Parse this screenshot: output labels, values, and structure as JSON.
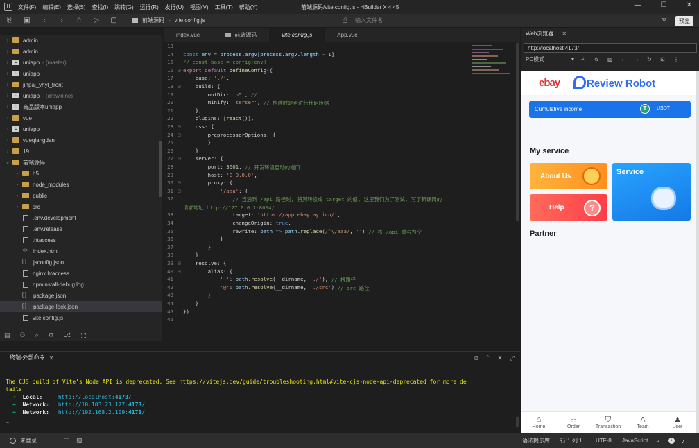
{
  "window": {
    "title": "前端源码/vite.config.js - HBuilder X 4.45",
    "menu": [
      "文件(F)",
      "编辑(E)",
      "选择(S)",
      "查找(I)",
      "跳转(G)",
      "运行(R)",
      "发行(U)",
      "视图(V)",
      "工具(T)",
      "帮助(Y)"
    ]
  },
  "toolbar": {
    "breadcrumb": [
      "前端源码",
      "vite.config.js"
    ],
    "search_placeholder": "输入文件名",
    "preview_label": "预览"
  },
  "sidebar": {
    "items": [
      {
        "label": "admin",
        "suffix": "",
        "level": 0,
        "icon": "folder",
        "arrow": "›"
      },
      {
        "label": "admin",
        "suffix": "",
        "level": 0,
        "icon": "folder",
        "arrow": "›"
      },
      {
        "label": "uniapp",
        "suffix": "- (master)",
        "level": 0,
        "icon": "u",
        "arrow": "›"
      },
      {
        "label": "uniapp",
        "suffix": "",
        "level": 0,
        "icon": "u",
        "arrow": "›"
      },
      {
        "label": "jinpai_yhyl_front",
        "suffix": "",
        "level": 0,
        "icon": "folder",
        "arrow": "›"
      },
      {
        "label": "uniapp",
        "suffix": "- (drawkline)",
        "level": 0,
        "icon": "u",
        "arrow": "›"
      },
      {
        "label": "商品版本uniapp",
        "suffix": "",
        "level": 0,
        "icon": "u",
        "arrow": "›"
      },
      {
        "label": "vue",
        "suffix": "",
        "level": 0,
        "icon": "folder",
        "arrow": "›"
      },
      {
        "label": "uniapp",
        "suffix": "",
        "level": 0,
        "icon": "u",
        "arrow": "›"
      },
      {
        "label": "vueqiangdan",
        "suffix": "",
        "level": 0,
        "icon": "folder",
        "arrow": "›"
      },
      {
        "label": "19",
        "suffix": "",
        "level": 0,
        "icon": "folder",
        "arrow": "›"
      },
      {
        "label": "前端源码",
        "suffix": "",
        "level": 0,
        "icon": "folder",
        "arrow": "⌄"
      },
      {
        "label": "h5",
        "suffix": "",
        "level": 1,
        "icon": "folder",
        "arrow": "›"
      },
      {
        "label": "node_modules",
        "suffix": "",
        "level": 1,
        "icon": "folder",
        "arrow": "›"
      },
      {
        "label": "public",
        "suffix": "",
        "level": 1,
        "icon": "folder",
        "arrow": "›"
      },
      {
        "label": "src",
        "suffix": "",
        "level": 1,
        "icon": "folder",
        "arrow": "›"
      },
      {
        "label": ".env.development",
        "suffix": "",
        "level": 1,
        "icon": "file",
        "arrow": ""
      },
      {
        "label": ".env.release",
        "suffix": "",
        "level": 1,
        "icon": "file",
        "arrow": ""
      },
      {
        "label": ".htaccess",
        "suffix": "",
        "level": 1,
        "icon": "file",
        "arrow": ""
      },
      {
        "label": "index.html",
        "suffix": "",
        "level": 1,
        "icon": "html",
        "arrow": ""
      },
      {
        "label": "jsconfig.json",
        "suffix": "",
        "level": 1,
        "icon": "json",
        "arrow": ""
      },
      {
        "label": "nginx.htaccess",
        "suffix": "",
        "level": 1,
        "icon": "file",
        "arrow": ""
      },
      {
        "label": "npminstall-debug.log",
        "suffix": "",
        "level": 1,
        "icon": "file",
        "arrow": ""
      },
      {
        "label": "package.json",
        "suffix": "",
        "level": 1,
        "icon": "json",
        "arrow": ""
      },
      {
        "label": "package-lock.json",
        "suffix": "",
        "level": 1,
        "icon": "json",
        "arrow": "",
        "selected": true
      },
      {
        "label": "vite.config.js",
        "suffix": "",
        "level": 1,
        "icon": "js",
        "arrow": ""
      }
    ]
  },
  "tabs": [
    {
      "label": "index.vue",
      "active": false
    },
    {
      "label": "前端源码",
      "active": false,
      "folder": true
    },
    {
      "label": "vite.config.js",
      "active": true
    },
    {
      "label": "App.vue",
      "active": false
    }
  ],
  "code": [
    {
      "n": "13",
      "f": "",
      "t": []
    },
    {
      "n": "14",
      "f": "",
      "t": [
        [
          "kb",
          "const "
        ],
        [
          "var",
          "env"
        ],
        [
          "txt",
          " = "
        ],
        [
          "var",
          "process"
        ],
        [
          "txt",
          "."
        ],
        [
          "var",
          "argv"
        ],
        [
          "txt",
          "["
        ],
        [
          "var",
          "process"
        ],
        [
          "txt",
          "."
        ],
        [
          "var",
          "argv"
        ],
        [
          "txt",
          "."
        ],
        [
          "var",
          "length"
        ],
        [
          "txt",
          " - "
        ],
        [
          "num",
          "1"
        ],
        [
          "txt",
          "]"
        ]
      ]
    },
    {
      "n": "15",
      "f": "",
      "t": [
        [
          "cm",
          "// const base = config[env]"
        ]
      ]
    },
    {
      "n": "16",
      "f": "⊟",
      "t": [
        [
          "kw",
          "export default "
        ],
        [
          "fn",
          "defineConfig"
        ],
        [
          "txt",
          "({"
        ]
      ]
    },
    {
      "n": "17",
      "f": "",
      "t": [
        [
          "txt",
          "    base: "
        ],
        [
          "str",
          "'./'"
        ],
        [
          "txt",
          ","
        ]
      ]
    },
    {
      "n": "18",
      "f": "⊟",
      "t": [
        [
          "txt",
          "    build: {"
        ]
      ]
    },
    {
      "n": "19",
      "f": "",
      "t": [
        [
          "txt",
          "        outDir: "
        ],
        [
          "str",
          "'h5'"
        ],
        [
          "txt",
          ", "
        ],
        [
          "cm",
          "//"
        ]
      ]
    },
    {
      "n": "20",
      "f": "",
      "t": [
        [
          "txt",
          "        minify: "
        ],
        [
          "str",
          "'terser'"
        ],
        [
          "txt",
          ", "
        ],
        [
          "cm",
          "// 构建时是否进行代码压缩"
        ]
      ]
    },
    {
      "n": "21",
      "f": "",
      "t": [
        [
          "txt",
          "    },"
        ]
      ]
    },
    {
      "n": "22",
      "f": "",
      "t": [
        [
          "txt",
          "    plugins: ["
        ],
        [
          "fn",
          "react"
        ],
        [
          "txt",
          "()],"
        ]
      ]
    },
    {
      "n": "23",
      "f": "⊟",
      "t": [
        [
          "txt",
          "    css: {"
        ]
      ]
    },
    {
      "n": "24",
      "f": "⊟",
      "t": [
        [
          "txt",
          "        preprocessorOptions: {"
        ]
      ]
    },
    {
      "n": "25",
      "f": "",
      "t": [
        [
          "txt",
          "        }"
        ]
      ]
    },
    {
      "n": "26",
      "f": "",
      "t": [
        [
          "txt",
          "    },"
        ]
      ]
    },
    {
      "n": "27",
      "f": "⊟",
      "t": [
        [
          "txt",
          "    server: {"
        ]
      ]
    },
    {
      "n": "28",
      "f": "",
      "t": [
        [
          "txt",
          "        port: "
        ],
        [
          "num",
          "3001"
        ],
        [
          "txt",
          ", "
        ],
        [
          "cm",
          "// 开发环境启动的端口"
        ]
      ]
    },
    {
      "n": "29",
      "f": "",
      "t": [
        [
          "txt",
          "        host: "
        ],
        [
          "str",
          "'0.0.0.0'"
        ],
        [
          "txt",
          ","
        ]
      ]
    },
    {
      "n": "30",
      "f": "⊟",
      "t": [
        [
          "txt",
          "        proxy: {"
        ]
      ]
    },
    {
      "n": "31",
      "f": "⊟",
      "t": [
        [
          "txt",
          "            "
        ],
        [
          "str",
          "'/aaa'"
        ],
        [
          "txt",
          ": {"
        ]
      ]
    },
    {
      "n": "32",
      "f": "",
      "t": [
        [
          "cm",
          "                // 当遇到 /api 路径时, 将其转换成 target 的值, 这里我们为了测试, 写了新课网的"
        ]
      ]
    },
    {
      "n": "",
      "f": "",
      "t": [
        [
          "cm",
          "请求地址 http://127.0.0.1:8004/"
        ]
      ]
    },
    {
      "n": "33",
      "f": "",
      "t": [
        [
          "txt",
          "                target: "
        ],
        [
          "str",
          "'https://app.ebaytay.icu/'"
        ],
        [
          "txt",
          ","
        ]
      ]
    },
    {
      "n": "34",
      "f": "",
      "t": [
        [
          "txt",
          "                changeOrigin: "
        ],
        [
          "kb",
          "true"
        ],
        [
          "txt",
          ","
        ]
      ]
    },
    {
      "n": "35",
      "f": "",
      "t": [
        [
          "txt",
          "                rewrite: "
        ],
        [
          "var",
          "path"
        ],
        [
          "kb",
          " => "
        ],
        [
          "var",
          "path"
        ],
        [
          "txt",
          "."
        ],
        [
          "fn",
          "replace"
        ],
        [
          "txt",
          "("
        ],
        [
          "str",
          "/^\\/aaa/"
        ],
        [
          "txt",
          ", "
        ],
        [
          "str",
          "''"
        ],
        [
          "txt",
          ") "
        ],
        [
          "cm",
          "// 将 /api 重写为空"
        ]
      ]
    },
    {
      "n": "36",
      "f": "",
      "t": [
        [
          "txt",
          "            }"
        ]
      ]
    },
    {
      "n": "37",
      "f": "",
      "t": [
        [
          "txt",
          "        }"
        ]
      ]
    },
    {
      "n": "38",
      "f": "",
      "t": [
        [
          "txt",
          "    },"
        ]
      ]
    },
    {
      "n": "39",
      "f": "⊟",
      "t": [
        [
          "txt",
          "    resolve: {"
        ]
      ]
    },
    {
      "n": "40",
      "f": "⊟",
      "t": [
        [
          "txt",
          "        alias: {"
        ]
      ]
    },
    {
      "n": "41",
      "f": "",
      "t": [
        [
          "txt",
          "            "
        ],
        [
          "str",
          "'~'"
        ],
        [
          "txt",
          ": "
        ],
        [
          "var",
          "path"
        ],
        [
          "txt",
          "."
        ],
        [
          "fn",
          "resolve"
        ],
        [
          "txt",
          "(__dirname, "
        ],
        [
          "str",
          "'./'"
        ],
        [
          "txt",
          "), "
        ],
        [
          "cm",
          "// 根路径"
        ]
      ]
    },
    {
      "n": "42",
      "f": "",
      "t": [
        [
          "txt",
          "            "
        ],
        [
          "str",
          "'@'"
        ],
        [
          "txt",
          ": "
        ],
        [
          "var",
          "path"
        ],
        [
          "txt",
          "."
        ],
        [
          "fn",
          "resolve"
        ],
        [
          "txt",
          "(__dirname, "
        ],
        [
          "str",
          "'./src'"
        ],
        [
          "txt",
          ") "
        ],
        [
          "cm",
          "// src 路径"
        ]
      ]
    },
    {
      "n": "43",
      "f": "",
      "t": [
        [
          "txt",
          "        }"
        ]
      ]
    },
    {
      "n": "44",
      "f": "",
      "t": [
        [
          "txt",
          "    }"
        ]
      ]
    },
    {
      "n": "45",
      "f": "",
      "t": [
        [
          "txt",
          "})"
        ]
      ]
    },
    {
      "n": "46",
      "f": "",
      "t": []
    }
  ],
  "terminal": {
    "tab_label": "终端-外部命令",
    "warning": "The CJS build of Vite's Node API is deprecated. See https://vitejs.dev/guide/troubleshooting.html#vite-cjs-node-api-deprecated for more de",
    "warning2": "tails.",
    "lines": [
      {
        "label": "Local:   ",
        "url_pre": "http://localhost:",
        "port": "4173",
        "url_post": "/"
      },
      {
        "label": "Network: ",
        "url_pre": "http://10.103.23.177:",
        "port": "4173",
        "url_post": "/"
      },
      {
        "label": "Network: ",
        "url_pre": "http://192.168.2.109:",
        "port": "4173",
        "url_post": "/"
      }
    ],
    "prompt": "_"
  },
  "statusbar": {
    "login": "未登录",
    "hint": "语法提示库",
    "position": "行:1  列:1",
    "encoding": "UTF-8",
    "language": "JavaScript"
  },
  "browser": {
    "tab_label": "Web浏览器",
    "url": "http://localhost:4173/",
    "device": "PC模式",
    "page": {
      "logo_ebay": "ebay",
      "logo_robot": "Review Robot",
      "income_label": "Cumulative income",
      "currency": "USDT",
      "section_service": "My service",
      "about_label": "About Us",
      "help_label": "Help",
      "service_label": "Service",
      "section_partner": "Partner",
      "nav": [
        "Home",
        "Order",
        "Transaction",
        "Team",
        "User"
      ]
    },
    "colors": {
      "income_bar": "#1a73e8",
      "service_card": "#1c8ef0",
      "about_card": "#ff9a1f",
      "help_card": "#ff4b4b",
      "robot_blue": "#2f6df5"
    }
  }
}
